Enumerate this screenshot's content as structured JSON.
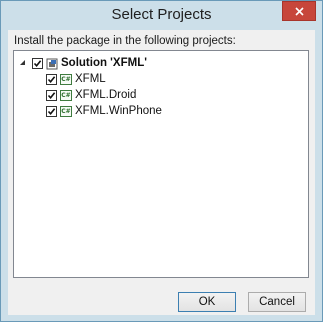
{
  "window": {
    "title": "Select Projects"
  },
  "instruction": "Install the package in the following projects:",
  "tree": {
    "solution": {
      "label": "Solution 'XFML'",
      "checked": true,
      "expanded": true
    },
    "projects": [
      {
        "label": "XFML",
        "checked": true,
        "icon": "csharp-project-icon",
        "icon_text": "C#"
      },
      {
        "label": "XFML.Droid",
        "checked": true,
        "icon": "csharp-project-icon",
        "icon_text": "C#"
      },
      {
        "label": "XFML.WinPhone",
        "checked": true,
        "icon": "csharp-project-icon",
        "icon_text": "C#"
      }
    ]
  },
  "buttons": {
    "ok": "OK",
    "cancel": "Cancel"
  },
  "colors": {
    "titlebar": "#ccdfe9",
    "close": "#c7463b",
    "client": "#f0f0f0"
  }
}
